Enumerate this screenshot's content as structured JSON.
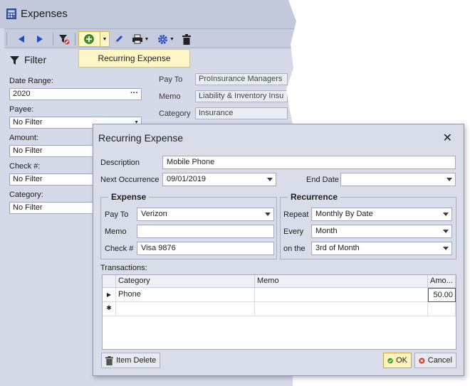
{
  "window": {
    "title": "Expenses"
  },
  "toolbar": {
    "tooltip": "Recurring Expense",
    "icons": [
      "arrow-left-icon",
      "arrow-right-icon",
      "filter-clear-icon",
      "add-icon",
      "pencil-icon",
      "printer-icon",
      "gear-icon",
      "trash-icon"
    ]
  },
  "filter": {
    "title": "Filter",
    "date_range_label": "Date Range:",
    "date_range_value": "2020",
    "payee_label": "Payee:",
    "payee_value": "No Filter",
    "amount_label": "Amount:",
    "amount_value": "No Filter",
    "check_label": "Check #:",
    "check_value": "No Filter",
    "category_label": "Category:",
    "category_value": "No Filter"
  },
  "detail": {
    "payto_label": "Pay To",
    "payto_value": "ProInsurance Managers",
    "memo_label": "Memo",
    "memo_value": "Liability & Inventory Insu",
    "category_label": "Category",
    "category_value": "Insurance"
  },
  "dialog": {
    "title": "Recurring Expense",
    "close_glyph": "✕",
    "description_label": "Description",
    "description_value": "Mobile Phone",
    "next_occurrence_label": "Next Occurrence",
    "next_occurrence_value": "09/01/2019",
    "end_date_label": "End Date",
    "end_date_value": "",
    "expense_group": {
      "title": "Expense",
      "payto_label": "Pay To",
      "payto_value": "Verizon",
      "memo_label": "Memo",
      "memo_value": "",
      "check_label": "Check #",
      "check_value": "Visa 9876"
    },
    "recurrence_group": {
      "title": "Recurrence",
      "repeat_label": "Repeat",
      "repeat_value": "Monthly By Date",
      "every_label": "Every",
      "every_value": "Month",
      "onthe_label": "on the",
      "onthe_value": "3rd of Month"
    },
    "transactions_label": "Transactions:",
    "grid": {
      "columns": [
        "Category",
        "Memo",
        "Amo..."
      ],
      "rows": [
        {
          "category": "Phone",
          "memo": "",
          "amount": "50.00"
        }
      ],
      "new_row_glyph": "✱"
    },
    "item_delete_label": "Item Delete",
    "ok_label": "OK",
    "cancel_label": "Cancel"
  },
  "colors": {
    "accent_green": "#3d9b1e",
    "nav_blue": "#1f4fc2",
    "cancel_red": "#d23a2a",
    "tooltip_bg": "#fff7c6"
  }
}
